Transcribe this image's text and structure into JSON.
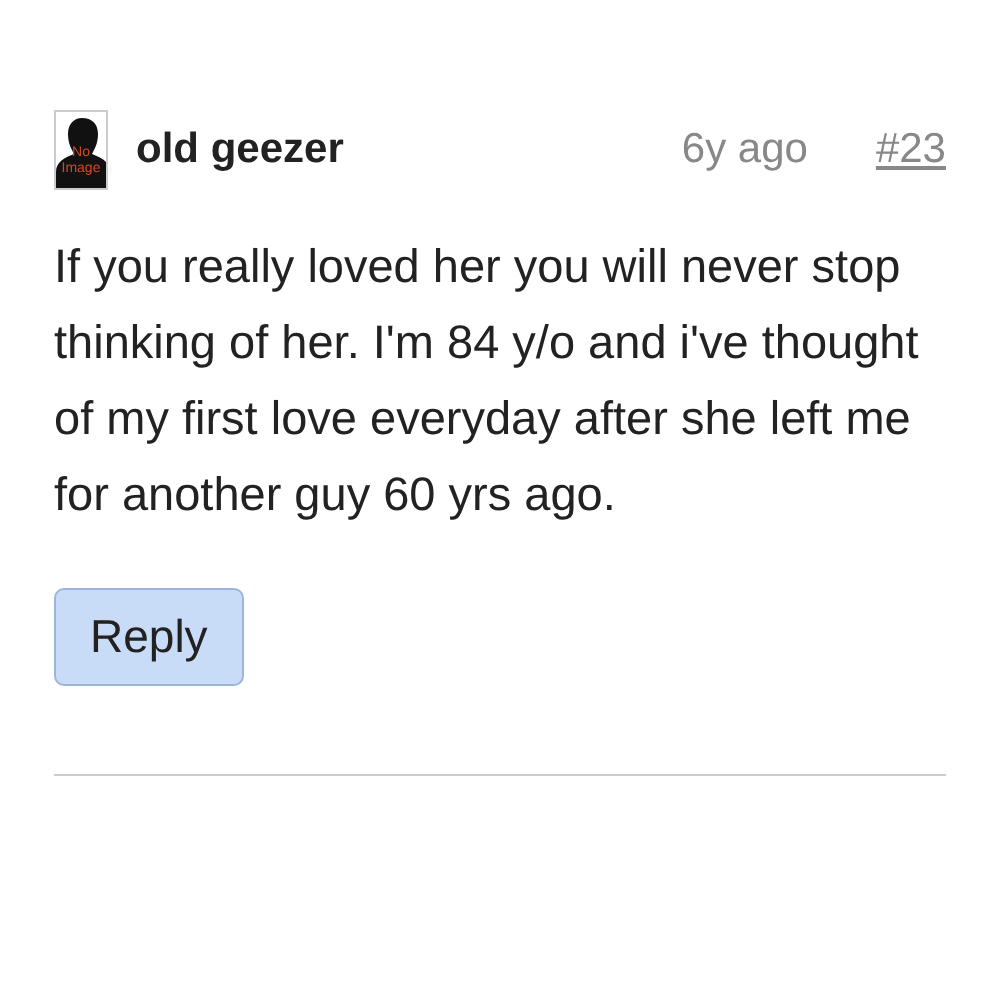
{
  "comment": {
    "author": "old geezer",
    "avatar_text": "No Image",
    "time": "6y ago",
    "number": "#23",
    "body": "If you really loved her you will never stop thinking of her. I'm 84 y/o and i've thought of my first love everyday after she left me for another guy 60 yrs ago.",
    "buttons": [
      "Reply"
    ]
  }
}
